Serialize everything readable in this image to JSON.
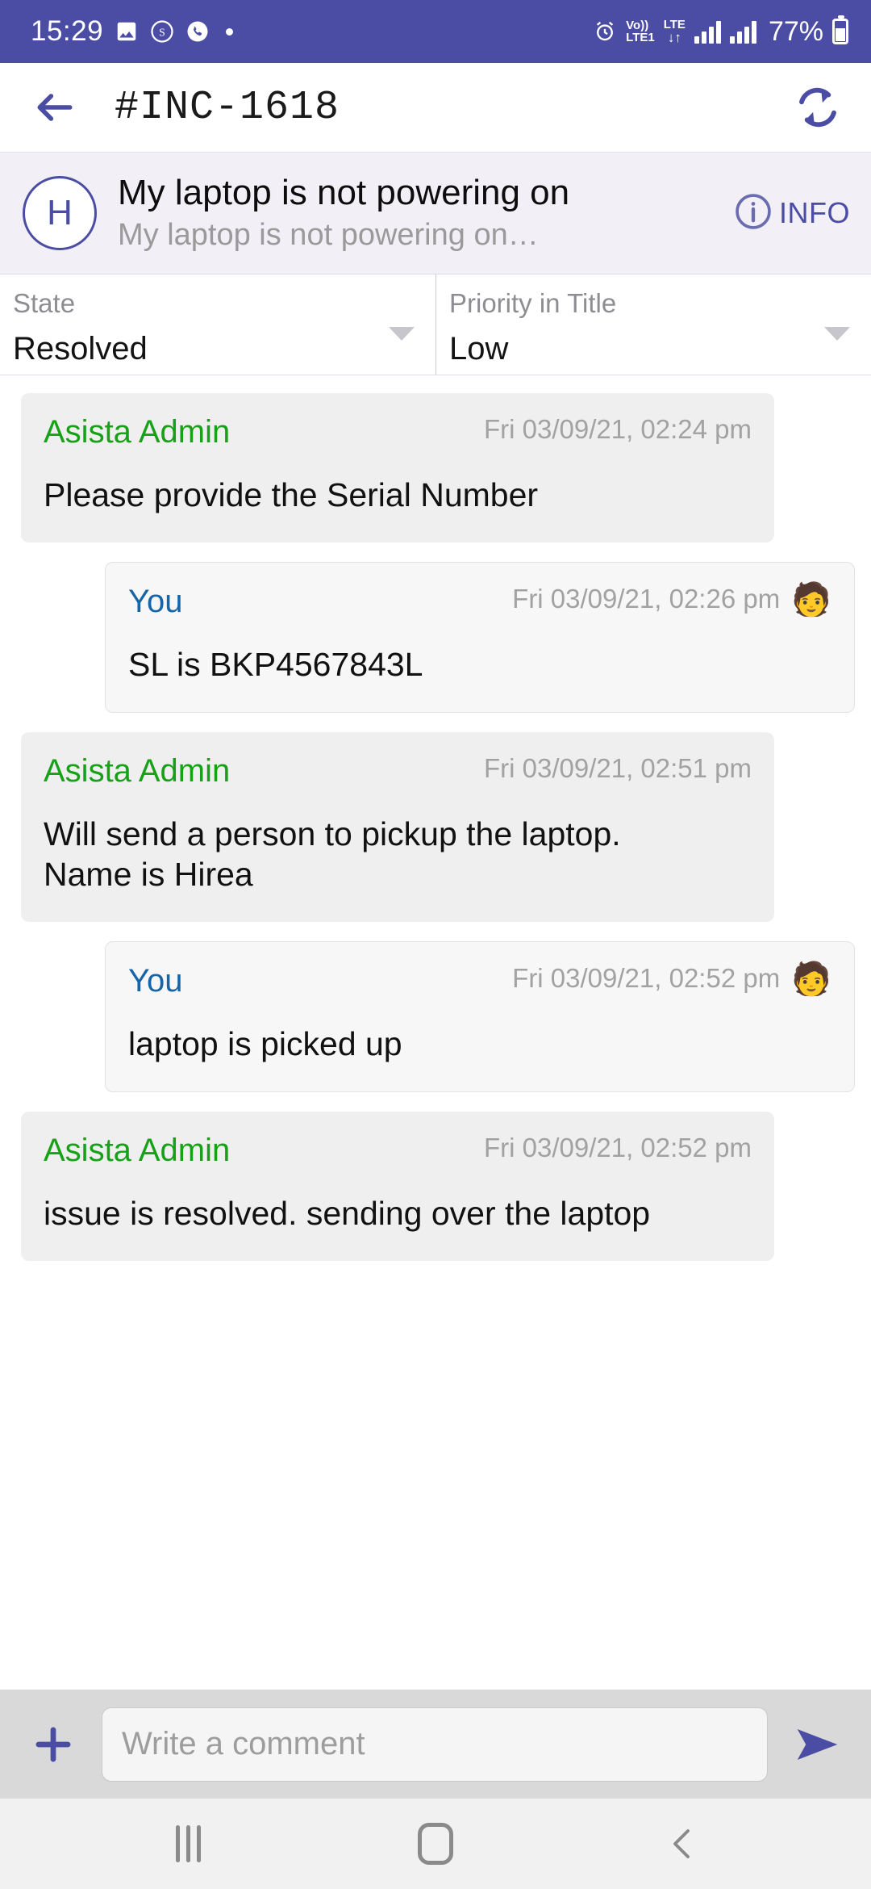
{
  "status_bar": {
    "time": "15:29",
    "icons": [
      "image-icon",
      "skype-icon",
      "phone-icon",
      "dot-indicator"
    ],
    "alarm_icon": "alarm-icon",
    "volte_label": "Vo))",
    "volte_sub": "LTE1",
    "lte_label": "LTE",
    "data_arrows": "↓↑",
    "battery_percent": "77%"
  },
  "app_bar": {
    "back_icon": "back-arrow-icon",
    "title": "#INC-1618",
    "refresh_icon": "refresh-icon"
  },
  "ticket": {
    "avatar_initial": "H",
    "title": "My laptop is not powering on",
    "subtitle": "My laptop is not powering on…",
    "info_label": "INFO",
    "info_icon": "info-circle-icon"
  },
  "fields": [
    {
      "label": "State",
      "value": "Resolved"
    },
    {
      "label": "Priority in Title",
      "value": "Low"
    }
  ],
  "messages": [
    {
      "side": "them",
      "sender": "Asista Admin",
      "timestamp": "Fri 03/09/21, 02:24 pm",
      "text": "Please provide the Serial Number",
      "emoji": ""
    },
    {
      "side": "me",
      "sender": "You",
      "timestamp": "Fri 03/09/21, 02:26 pm",
      "text": "SL is BKP4567843L",
      "emoji": "🧑"
    },
    {
      "side": "them",
      "sender": "Asista Admin",
      "timestamp": "Fri 03/09/21, 02:51 pm",
      "text": "Will send a person to pickup the laptop.\nName is Hirea",
      "emoji": ""
    },
    {
      "side": "me",
      "sender": "You",
      "timestamp": "Fri 03/09/21, 02:52 pm",
      "text": "laptop is picked up",
      "emoji": "🧑"
    },
    {
      "side": "them",
      "sender": "Asista Admin",
      "timestamp": "Fri 03/09/21, 02:52 pm",
      "text": "issue is resolved. sending over the laptop",
      "emoji": ""
    }
  ],
  "composer": {
    "attach_icon": "plus-icon",
    "placeholder": "Write a comment",
    "value": "",
    "send_icon": "send-icon"
  },
  "nav_bar": {
    "recents_icon": "recents-icon",
    "home_icon": "home-icon",
    "back_icon": "back-chevron-icon"
  },
  "colors": {
    "accent": "#4a4da3",
    "admin_name": "#17a117",
    "you_name": "#1565a8",
    "ticket_bg": "#f2eff6",
    "composer_bg": "#d9d9d9"
  }
}
